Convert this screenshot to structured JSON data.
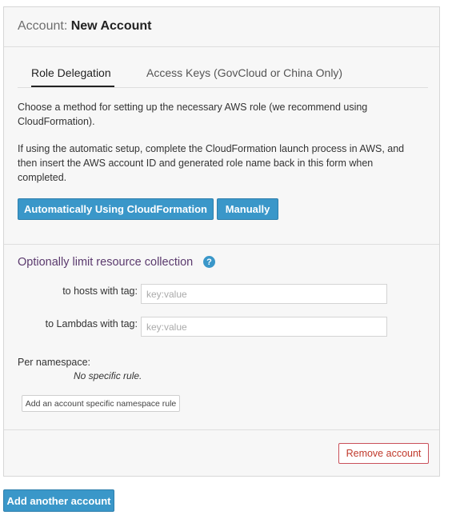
{
  "panel": {
    "header_prefix": "Account:",
    "header_name": "New Account"
  },
  "tabs": [
    {
      "label": "Role Delegation",
      "active": true
    },
    {
      "label": "Access Keys (GovCloud or China Only)",
      "active": false
    }
  ],
  "instructions": {
    "p1": "Choose a method for setting up the necessary AWS role (we recommend using CloudFormation).",
    "p2": "If using the automatic setup, complete the CloudFormation launch process in AWS, and then insert the AWS account ID and generated role name back in this form when completed."
  },
  "buttons": {
    "auto": "Automatically Using CloudFormation",
    "manual": "Manually",
    "add_rule": "Add an account specific namespace rule",
    "remove": "Remove account",
    "add_account": "Add another account"
  },
  "limits": {
    "title": "Optionally limit resource collection",
    "help_icon": "?",
    "hosts_label": "to hosts with tag:",
    "hosts_placeholder": "key:value",
    "hosts_value": "",
    "lambdas_label": "to Lambdas with tag:",
    "lambdas_placeholder": "key:value",
    "lambdas_value": ""
  },
  "namespace": {
    "label": "Per namespace:",
    "empty": "No specific rule."
  },
  "colors": {
    "primary": "#3a97c9",
    "danger": "#c0392b",
    "section_title": "#5b3a6e"
  }
}
